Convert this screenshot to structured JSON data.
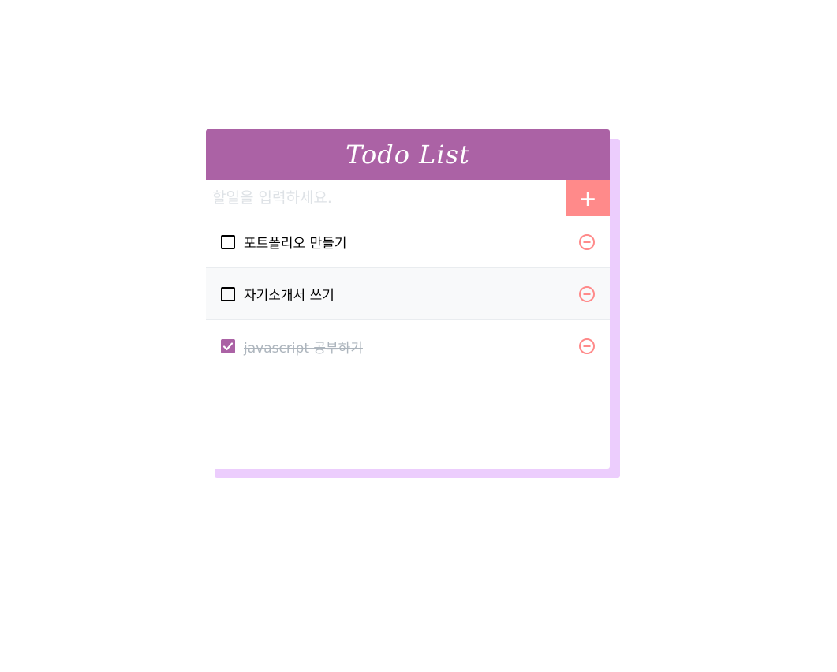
{
  "app": {
    "title": "Todo List"
  },
  "input": {
    "placeholder": "할일을 입력하세요.",
    "value": ""
  },
  "add_button": {
    "label": "+"
  },
  "todos": [
    {
      "text": "포트폴리오 만들기",
      "checked": false
    },
    {
      "text": "자기소개서 쓰기",
      "checked": false
    },
    {
      "text": "javascript 공부하기",
      "checked": true
    }
  ],
  "colors": {
    "header": "#ab62a5",
    "accent_shadow": "#eccdfd",
    "add_button": "#ff8a8a",
    "remove_icon": "#ff8a8a",
    "done_text": "#adb5bd"
  },
  "icons": {
    "add": "plus-icon",
    "remove": "minus-circle-icon",
    "check": "checkmark-icon"
  }
}
